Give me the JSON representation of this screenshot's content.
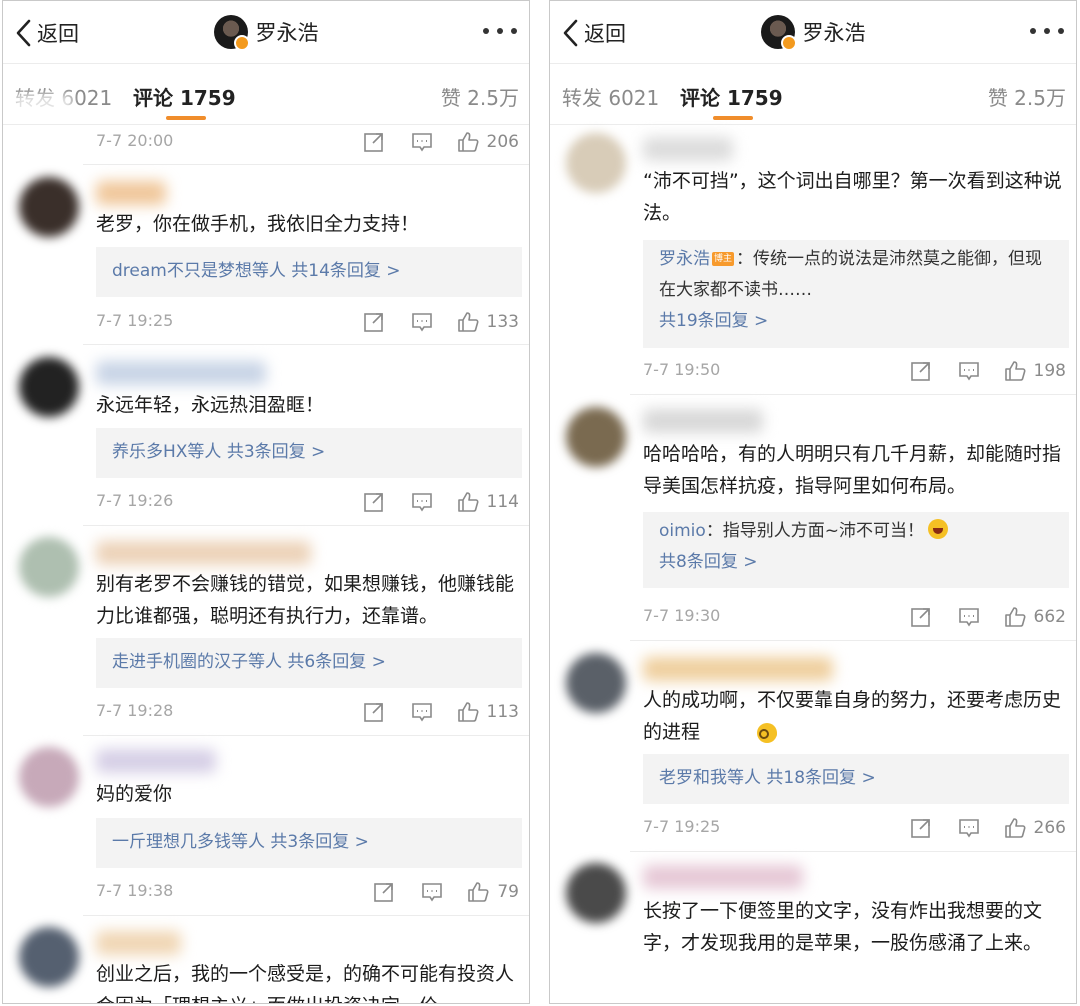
{
  "left": {
    "nav": {
      "back_label": "返回",
      "title": "罗永浩"
    },
    "tabs": {
      "forward": "转发 6021",
      "comments": "评论 1759",
      "likes": "赞 2.5万"
    },
    "top_meta": {
      "time": "7-7 20:00",
      "likes": "206"
    },
    "comments": [
      {
        "text": "老罗，你在做手机，我依旧全力支持！",
        "reply": "dream不只是梦想等人  共14条回复 >",
        "time": "7-7 19:25",
        "likes": "133"
      },
      {
        "text": "永远年轻，永远热泪盈眶！",
        "reply": "养乐多HX等人  共3条回复 >",
        "time": "7-7 19:26",
        "likes": "114"
      },
      {
        "text": "别有老罗不会赚钱的错觉，如果想赚钱，他赚钱能力比谁都强，聪明还有执行力，还靠谱。",
        "reply": "走进手机圈的汉子等人  共6条回复 >",
        "time": "7-7 19:28",
        "likes": "113"
      },
      {
        "text": "妈的爱你",
        "reply": "一斤理想几多钱等人  共3条回复 >",
        "time": "7-7 19:38",
        "likes": "79"
      },
      {
        "text": "创业之后，我的一个感受是，的确不可能有投资人会因为「理想主义」而做出投资决定，价"
      }
    ]
  },
  "right": {
    "nav": {
      "back_label": "返回",
      "title": "罗永浩"
    },
    "tabs": {
      "forward": "转发 6021",
      "comments": "评论 1759",
      "likes": "赞 2.5万"
    },
    "comments": [
      {
        "text": "“沛不可挡”，这个词出自哪里？第一次看到这种说法。",
        "quote_name": "罗永浩",
        "host_badge": "博主",
        "quote_text": "：传统一点的说法是沛然莫之能御，但现在大家都不读书……",
        "reply": "共19条回复 >",
        "time": "7-7 19:50",
        "likes": "198"
      },
      {
        "text": "哈哈哈哈，有的人明明只有几千月薪，却能随时指导美国怎样抗疫，指导阿里如何布局。",
        "quote_name": "oimio",
        "quote_text": "：指导别人方面~沛不可当！",
        "reply": "共8条回复 >",
        "time": "7-7 19:30",
        "likes": "662"
      },
      {
        "text": "人的成功啊，不仅要靠自身的努力，还要考虑历史的进程",
        "reply": "老罗和我等人  共18条回复 >",
        "time": "7-7 19:25",
        "likes": "266"
      },
      {
        "text": "长按了一下便签里的文字，没有炸出我想要的文字，才发现我用的是苹果，一股伤感涌了上来。"
      }
    ]
  },
  "colors": {
    "accent": "#f08d2b",
    "link": "#5b7aa9",
    "meta": "#a6a6a6",
    "reply_bg": "#f3f3f3"
  }
}
